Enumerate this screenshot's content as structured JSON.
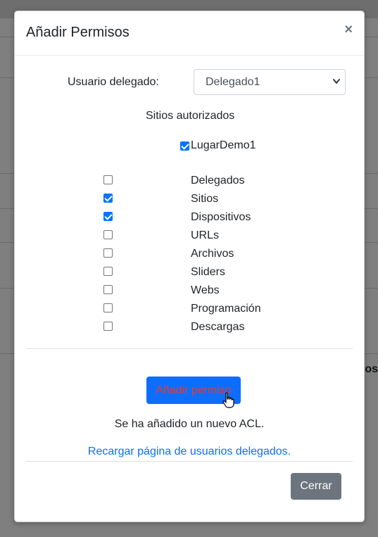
{
  "background": {
    "partial_text": "sos"
  },
  "modal": {
    "title": "Añadir Permisos",
    "close_glyph": "×",
    "user_label": "Usuario delegado:",
    "user_select_value": "Delegado1",
    "sites_title": "Sitios autorizados",
    "sites": [
      {
        "label": "LugarDemo1",
        "checked": true
      }
    ],
    "permissions": [
      {
        "label": "Delegados",
        "checked": false
      },
      {
        "label": "Sitios",
        "checked": true
      },
      {
        "label": "Dispositivos",
        "checked": true
      },
      {
        "label": "URLs",
        "checked": false
      },
      {
        "label": "Archivos",
        "checked": false
      },
      {
        "label": "Sliders",
        "checked": false
      },
      {
        "label": "Webs",
        "checked": false
      },
      {
        "label": "Programación",
        "checked": false
      },
      {
        "label": "Descargas",
        "checked": false
      }
    ],
    "add_button_label": "Añadir permiso",
    "status_message": "Se ha añadido un nuevo ACL.",
    "reload_link": "Recargar página de usuarios delegados.",
    "close_button_label": "Cerrar"
  },
  "colors": {
    "primary": "#0d6efd",
    "secondary": "#6c757d",
    "checkbox_checked": "#0075ff",
    "add_button_text": "#e53935"
  },
  "icons": {
    "close": "close-icon",
    "select_arrow": "chevron-down-icon",
    "cursor": "hand-pointer-icon"
  }
}
